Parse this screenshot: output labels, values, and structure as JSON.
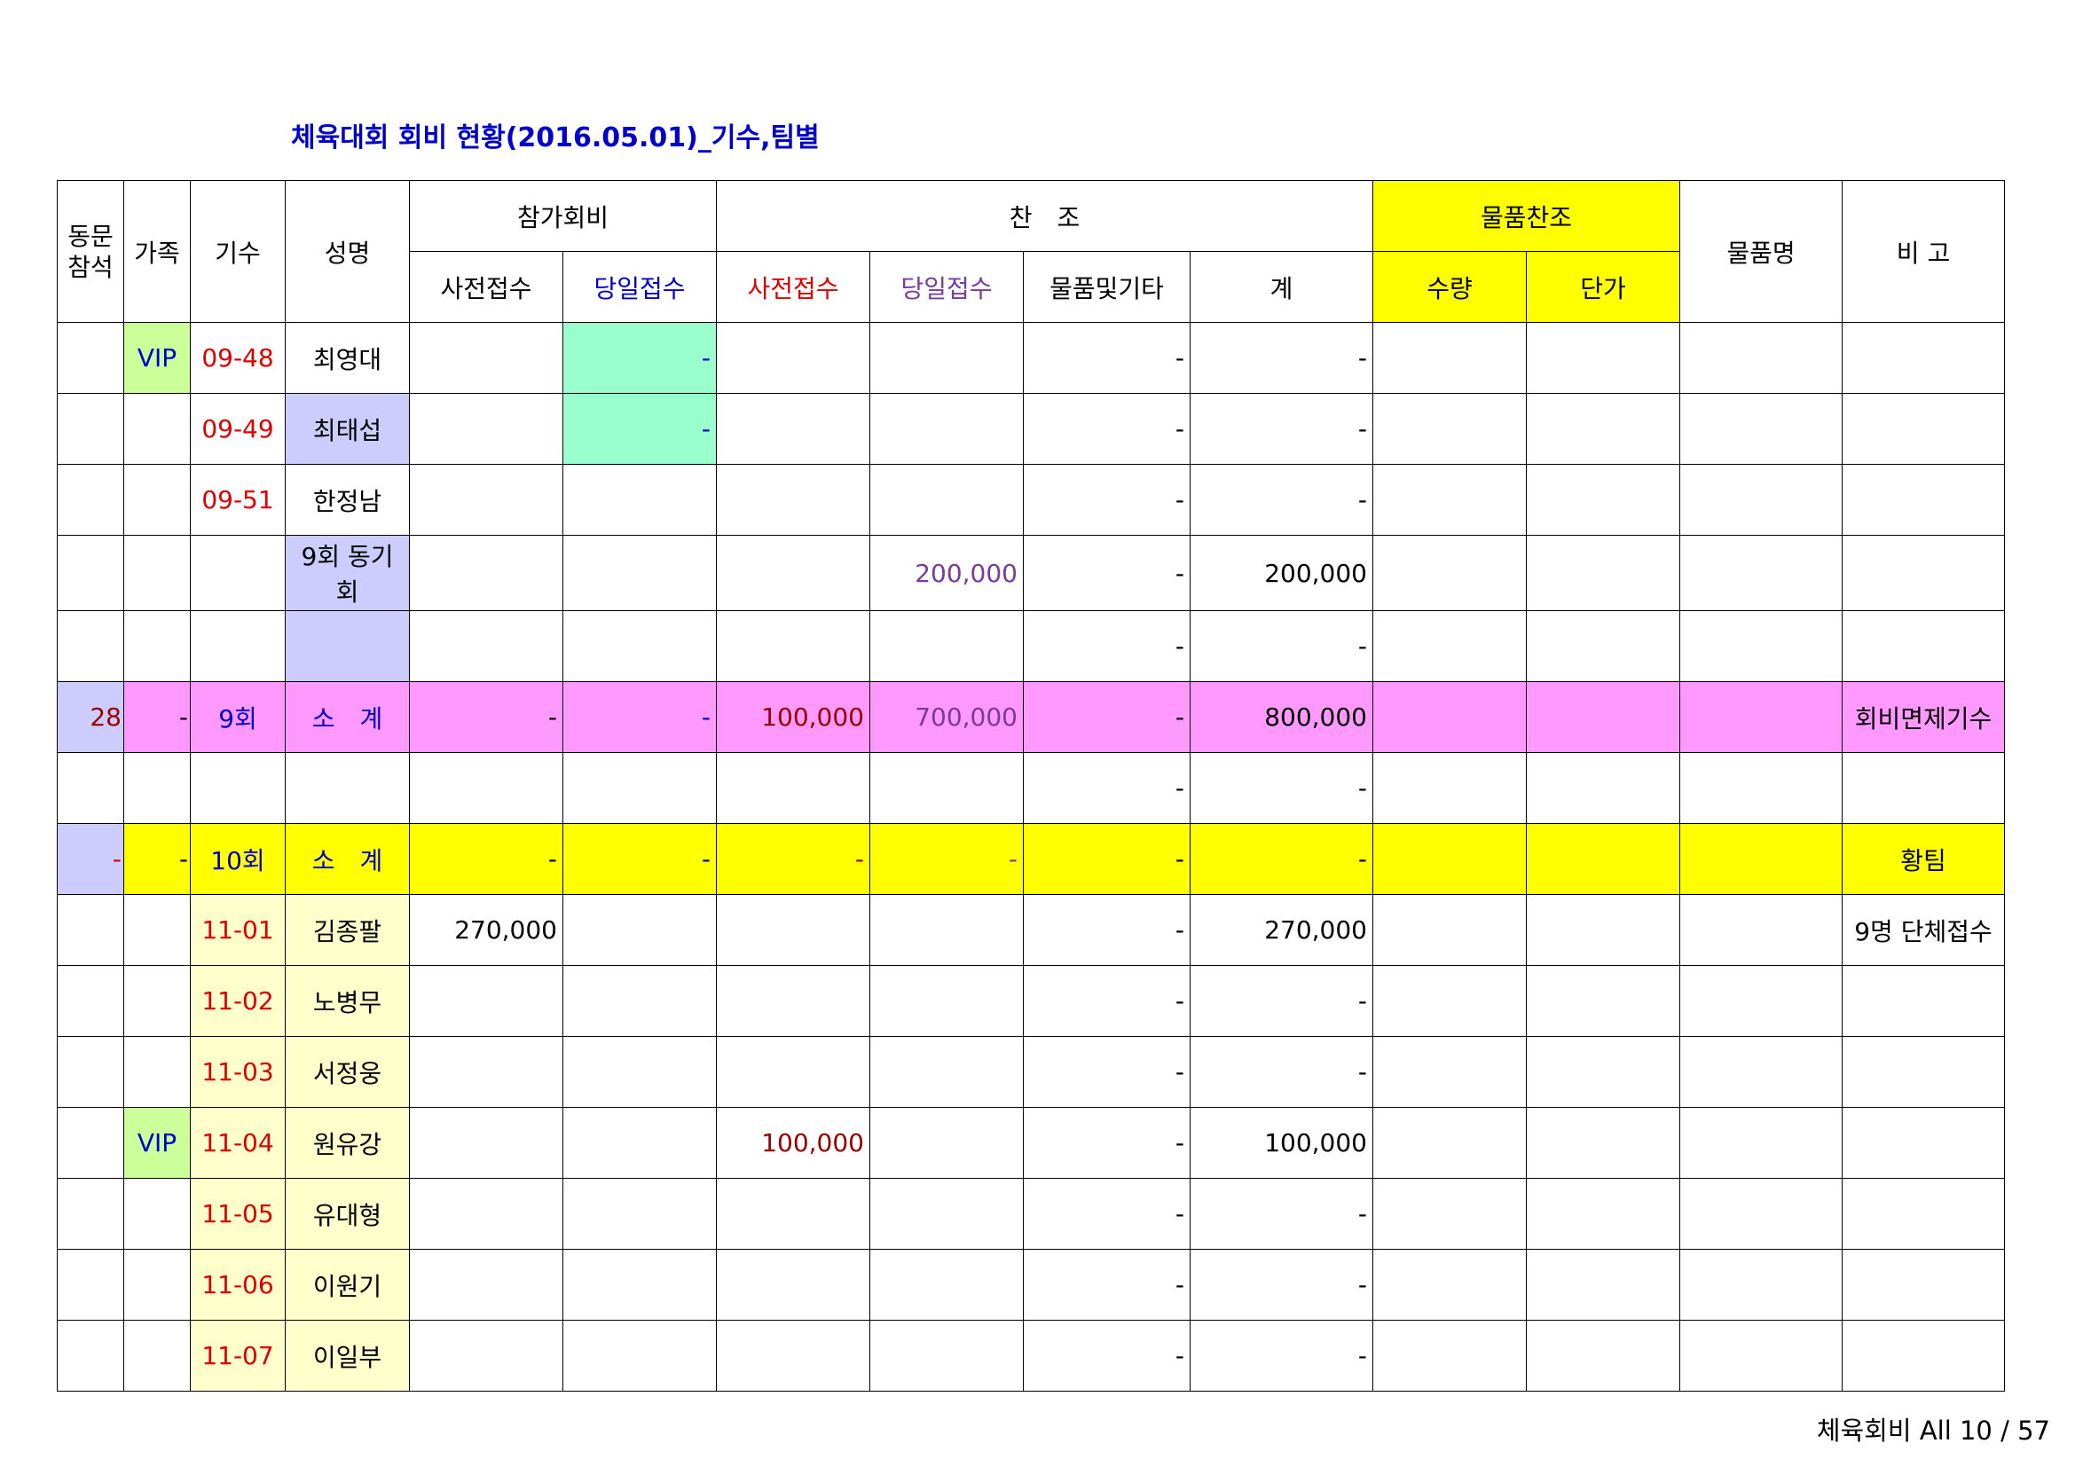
{
  "title": "체육대회 회비 현황(2016.05.01)_기수,팀별",
  "footer": "체육회비 All 10 / 57",
  "header": {
    "dongmun": "동문\n참석",
    "family": "가족",
    "gisu": "기수",
    "name": "성명",
    "fee_group": "참가회비",
    "sponsor_group": "찬　조",
    "goods_group": "물품찬조",
    "goods_name": "물품명",
    "note": "비 고",
    "fee_pre": "사전접수",
    "fee_day": "당일접수",
    "sp_pre": "사전접수",
    "sp_day": "당일접수",
    "sp_goods": "물품및기타",
    "sp_total": "계",
    "qty": "수량",
    "price": "단가"
  },
  "rows": [
    {
      "dongmun": "",
      "family": "VIP",
      "gisu": "09-48",
      "name": "최영대",
      "fee_pre": "",
      "fee_day": "-",
      "sp_pre": "",
      "sp_day": "",
      "sp_goods": "-",
      "sp_total": "-",
      "qty": "",
      "price": "",
      "goods_name": "",
      "note": ""
    },
    {
      "dongmun": "",
      "family": "",
      "gisu": "09-49",
      "name": "최태섭",
      "fee_pre": "",
      "fee_day": "-",
      "sp_pre": "",
      "sp_day": "",
      "sp_goods": "-",
      "sp_total": "-",
      "qty": "",
      "price": "",
      "goods_name": "",
      "note": ""
    },
    {
      "dongmun": "",
      "family": "",
      "gisu": "09-51",
      "name": "한정남",
      "fee_pre": "",
      "fee_day": "",
      "sp_pre": "",
      "sp_day": "",
      "sp_goods": "-",
      "sp_total": "-",
      "qty": "",
      "price": "",
      "goods_name": "",
      "note": ""
    },
    {
      "dongmun": "",
      "family": "",
      "gisu": "",
      "name": "9회 동기회",
      "fee_pre": "",
      "fee_day": "",
      "sp_pre": "",
      "sp_day": "200,000",
      "sp_goods": "-",
      "sp_total": "200,000",
      "qty": "",
      "price": "",
      "goods_name": "",
      "note": ""
    },
    {
      "dongmun": "",
      "family": "",
      "gisu": "",
      "name": "",
      "fee_pre": "",
      "fee_day": "",
      "sp_pre": "",
      "sp_day": "",
      "sp_goods": "-",
      "sp_total": "-",
      "qty": "",
      "price": "",
      "goods_name": "",
      "note": ""
    },
    {
      "dongmun": "28",
      "family": "-",
      "gisu": "9회",
      "name": "소　계",
      "fee_pre": "-",
      "fee_day": "-",
      "sp_pre": "100,000",
      "sp_day": "700,000",
      "sp_goods": "-",
      "sp_total": "800,000",
      "qty": "",
      "price": "",
      "goods_name": "",
      "note": "회비면제기수"
    },
    {
      "dongmun": "",
      "family": "",
      "gisu": "",
      "name": "",
      "fee_pre": "",
      "fee_day": "",
      "sp_pre": "",
      "sp_day": "",
      "sp_goods": "-",
      "sp_total": "-",
      "qty": "",
      "price": "",
      "goods_name": "",
      "note": ""
    },
    {
      "dongmun": "-",
      "family": "-",
      "gisu": "10회",
      "name": "소　계",
      "fee_pre": "-",
      "fee_day": "-",
      "sp_pre": "-",
      "sp_day": "-",
      "sp_goods": "-",
      "sp_total": "-",
      "qty": "",
      "price": "",
      "goods_name": "",
      "note": "황팀"
    },
    {
      "dongmun": "",
      "family": "",
      "gisu": "11-01",
      "name": "김종팔",
      "fee_pre": "270,000",
      "fee_day": "",
      "sp_pre": "",
      "sp_day": "",
      "sp_goods": "-",
      "sp_total": "270,000",
      "qty": "",
      "price": "",
      "goods_name": "",
      "note": "9명 단체접수"
    },
    {
      "dongmun": "",
      "family": "",
      "gisu": "11-02",
      "name": "노병무",
      "fee_pre": "",
      "fee_day": "",
      "sp_pre": "",
      "sp_day": "",
      "sp_goods": "-",
      "sp_total": "-",
      "qty": "",
      "price": "",
      "goods_name": "",
      "note": ""
    },
    {
      "dongmun": "",
      "family": "",
      "gisu": "11-03",
      "name": "서정웅",
      "fee_pre": "",
      "fee_day": "",
      "sp_pre": "",
      "sp_day": "",
      "sp_goods": "-",
      "sp_total": "-",
      "qty": "",
      "price": "",
      "goods_name": "",
      "note": ""
    },
    {
      "dongmun": "",
      "family": "VIP",
      "gisu": "11-04",
      "name": "원유강",
      "fee_pre": "",
      "fee_day": "",
      "sp_pre": "100,000",
      "sp_day": "",
      "sp_goods": "-",
      "sp_total": "100,000",
      "qty": "",
      "price": "",
      "goods_name": "",
      "note": ""
    },
    {
      "dongmun": "",
      "family": "",
      "gisu": "11-05",
      "name": "유대형",
      "fee_pre": "",
      "fee_day": "",
      "sp_pre": "",
      "sp_day": "",
      "sp_goods": "-",
      "sp_total": "-",
      "qty": "",
      "price": "",
      "goods_name": "",
      "note": ""
    },
    {
      "dongmun": "",
      "family": "",
      "gisu": "11-06",
      "name": "이원기",
      "fee_pre": "",
      "fee_day": "",
      "sp_pre": "",
      "sp_day": "",
      "sp_goods": "-",
      "sp_total": "-",
      "qty": "",
      "price": "",
      "goods_name": "",
      "note": ""
    },
    {
      "dongmun": "",
      "family": "",
      "gisu": "11-07",
      "name": "이일부",
      "fee_pre": "",
      "fee_day": "",
      "sp_pre": "",
      "sp_day": "",
      "sp_goods": "-",
      "sp_total": "-",
      "qty": "",
      "price": "",
      "goods_name": "",
      "note": ""
    }
  ],
  "colors": {
    "title": "#0000cc",
    "gisu_red": "#dd0000",
    "vip_blue": "#0000cc",
    "sponsor_pre": "#990000",
    "sponsor_day": "#7a3aa0",
    "goods_header_bg": "#ffff00",
    "subtotal_9_bg": "#ff99ff",
    "subtotal_10_bg": "#ffff00",
    "vip_bg": "#ccff99",
    "fee_day_bg": "#99ffcc",
    "name_bg": "#ccccff",
    "gisu11_bg": "#ffffcc"
  }
}
